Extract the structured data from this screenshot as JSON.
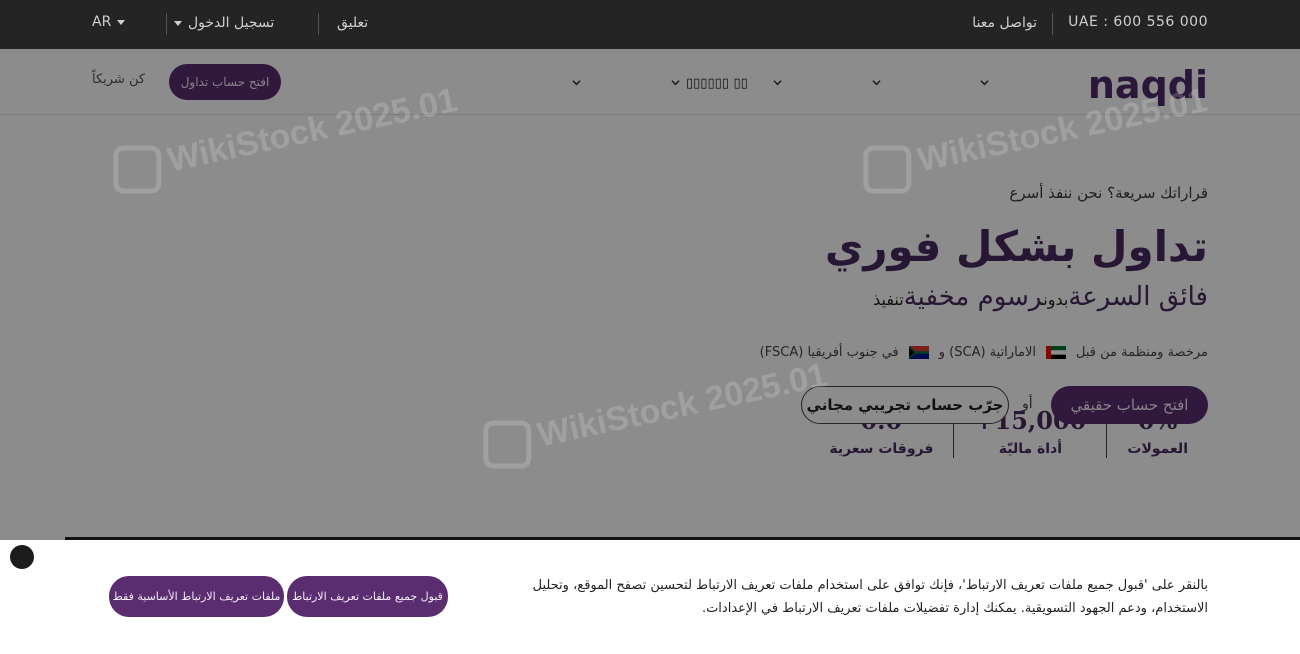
{
  "topbar": {
    "phone": "UAE : 600 556 000",
    "contact": "تواصل معنا",
    "feedback": "تعليق",
    "login": "تسجيل الدخول",
    "lang": "AR"
  },
  "navbar": {
    "logo": "naqdi",
    "menu_obscured": "▯▯▯▯▯▯ ▯▯",
    "open_account": "افتح حساب تداول",
    "partner": "كن شريكاً"
  },
  "hero": {
    "tagline": "قراراتك سريعة؟ نحن ننفذ أسرع",
    "headline": "تداول بشكل فوري",
    "subhead_fast": "فائق السرعة",
    "subhead_without": "بدون",
    "subhead_fees": "رسوم مخفية",
    "subhead_exec": "تنفيذ",
    "license_prefix": "مرخصة ومنظمة من قبل",
    "license_uae": "الاماراتية (SCA) و",
    "license_za": "في جنوب أفريقيا (FSCA)",
    "stats": [
      {
        "value": "0%",
        "label": "العمولات"
      },
      {
        "value": "15,000+",
        "label": "أداة ماليّة"
      },
      {
        "value": "0.0",
        "label": "فروقات سعرية"
      }
    ],
    "btn_real": "افتح حساب حقيقي",
    "or": "أو",
    "btn_demo": "جرّب حساب تجريبي مجاني"
  },
  "watermark": "WikiStock 2025.01",
  "cookie": {
    "text": "بالنقر على 'قبول جميع ملفات تعريف الارتباط'، فإنك توافق على استخدام ملفات تعريف الارتباط لتحسين تصفح الموقع، وتحليل الاستخدام، ودعم الجهود التسويقية. يمكنك إدارة تفضيلات ملفات تعريف الارتباط في الإعدادات.",
    "accept_all": "قبول جميع ملفات تعريف الارتباط",
    "basic_only": "ملفات تعريف الارتباط الأساسية فقط"
  },
  "colors": {
    "brand": "#5a2d70",
    "topbar": "#242424"
  }
}
